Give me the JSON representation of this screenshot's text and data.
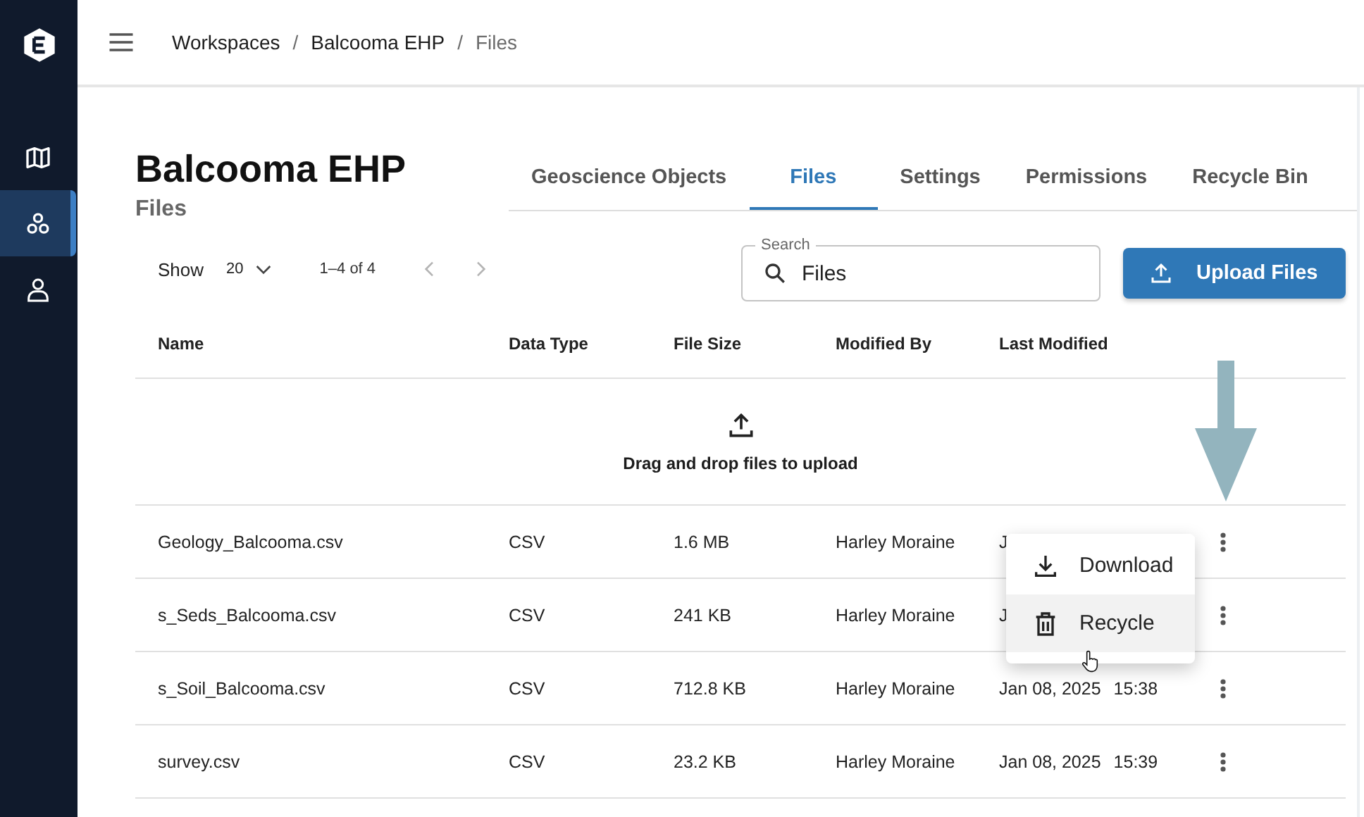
{
  "sidebar": {
    "items": [
      {
        "kind": "map",
        "selected": false
      },
      {
        "kind": "workspaces",
        "selected": true
      },
      {
        "kind": "account",
        "selected": false
      }
    ]
  },
  "breadcrumb": [
    {
      "label": "Workspaces",
      "separator": "/",
      "current": false
    },
    {
      "label": "Balcooma EHP",
      "separator": "/",
      "current": false
    },
    {
      "label": "Files",
      "current": true
    }
  ],
  "header": {
    "title": "Balcooma EHP",
    "subtitle": "Files"
  },
  "tabs": [
    {
      "label": "Geoscience Objects",
      "selected": false
    },
    {
      "label": "Files",
      "selected": true
    },
    {
      "label": "Settings",
      "selected": false
    },
    {
      "label": "Permissions",
      "selected": false
    },
    {
      "label": "Recycle Bin",
      "selected": false
    }
  ],
  "toolbar": {
    "show_label": "Show",
    "page_size": "20",
    "range": "1–4 of 4",
    "prev": {
      "disabled": true
    },
    "next": {
      "disabled": true
    },
    "search": {
      "label": "Search",
      "value": "Files"
    },
    "upload_button": "Upload Files"
  },
  "table": {
    "columns": [
      "Name",
      "Data Type",
      "File Size",
      "Modified By",
      "Last Modified"
    ],
    "dropzone": "Drag and drop files to upload",
    "rows": [
      {
        "name": "Geology_Balcooma.csv",
        "type": "CSV",
        "size": "1.6 MB",
        "modified_by": "Harley Moraine",
        "date": "J"
      },
      {
        "name": "s_Seds_Balcooma.csv",
        "type": "CSV",
        "size": "241 KB",
        "modified_by": "Harley Moraine",
        "date": "J"
      },
      {
        "name": "s_Soil_Balcooma.csv",
        "type": "CSV",
        "size": "712.8 KB",
        "modified_by": "Harley Moraine",
        "date": "Jan 08, 2025",
        "time": "15:38"
      },
      {
        "name": "survey.csv",
        "type": "CSV",
        "size": "23.2 KB",
        "modified_by": "Harley Moraine",
        "date": "Jan 08, 2025",
        "time": "15:39"
      }
    ]
  },
  "menu": {
    "items": [
      {
        "kind": "download",
        "label": "Download",
        "highlighted": false
      },
      {
        "kind": "recycle",
        "label": "Recycle",
        "highlighted": true
      }
    ]
  }
}
